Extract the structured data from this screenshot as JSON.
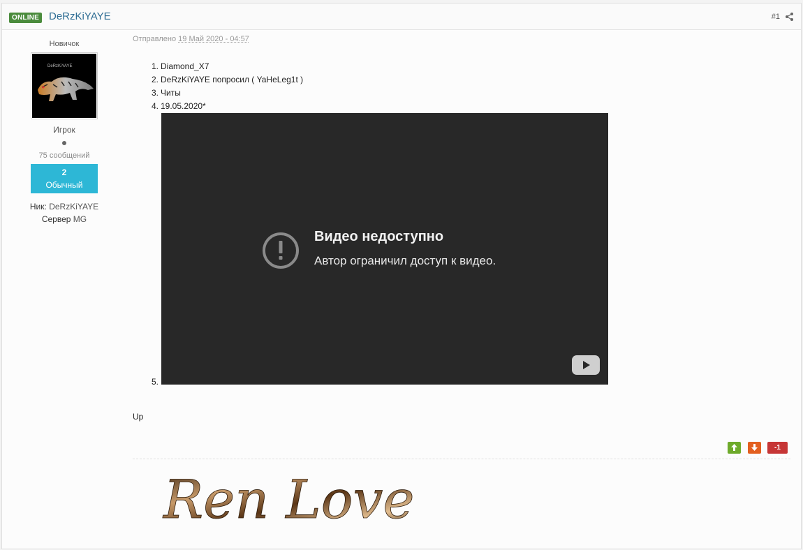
{
  "header": {
    "status_badge": "ONLINE",
    "author_name": "DeRzKiYAYE",
    "post_number": "#1"
  },
  "sidebar": {
    "rank": "Новичок",
    "avatar_caption": "DeRzKiYAYE",
    "group": "Игрок",
    "posts_count": "75 сообщений",
    "reputation_value": "2",
    "reputation_label": "Обычный",
    "nick_key": "Ник:",
    "nick_value": "DeRzKiYAYE",
    "server_key": "Сервер",
    "server_value": "MG"
  },
  "post": {
    "posted_prefix": "Отправлено",
    "posted_date": "19 Май 2020 - 04:57",
    "list": [
      {
        "num": "1.",
        "text": "Diamond_X7"
      },
      {
        "num": "2.",
        "text": "DeRzKiYAYE попросил ( YaHeLeg1t )"
      },
      {
        "num": "3.",
        "text": "Читы"
      },
      {
        "num": "4.",
        "text": "19.05.2020*"
      }
    ],
    "item5_num": "5.",
    "video": {
      "title": "Видео недоступно",
      "subtitle": "Автор ограничил доступ к видео."
    },
    "body_text": "Up"
  },
  "votes": {
    "up_icon": "arrow-up-icon",
    "down_icon": "arrow-down-icon",
    "count": "-1"
  },
  "signature": {
    "text": "Ren Love"
  },
  "colors": {
    "online_badge": "#4a8b3c",
    "author_link": "#2d6c93",
    "reputation_bg": "#2db7d6",
    "vote_up": "#6eaa2b",
    "vote_down": "#e35f1f",
    "vote_count": "#c63636",
    "video_bg": "#282828"
  }
}
